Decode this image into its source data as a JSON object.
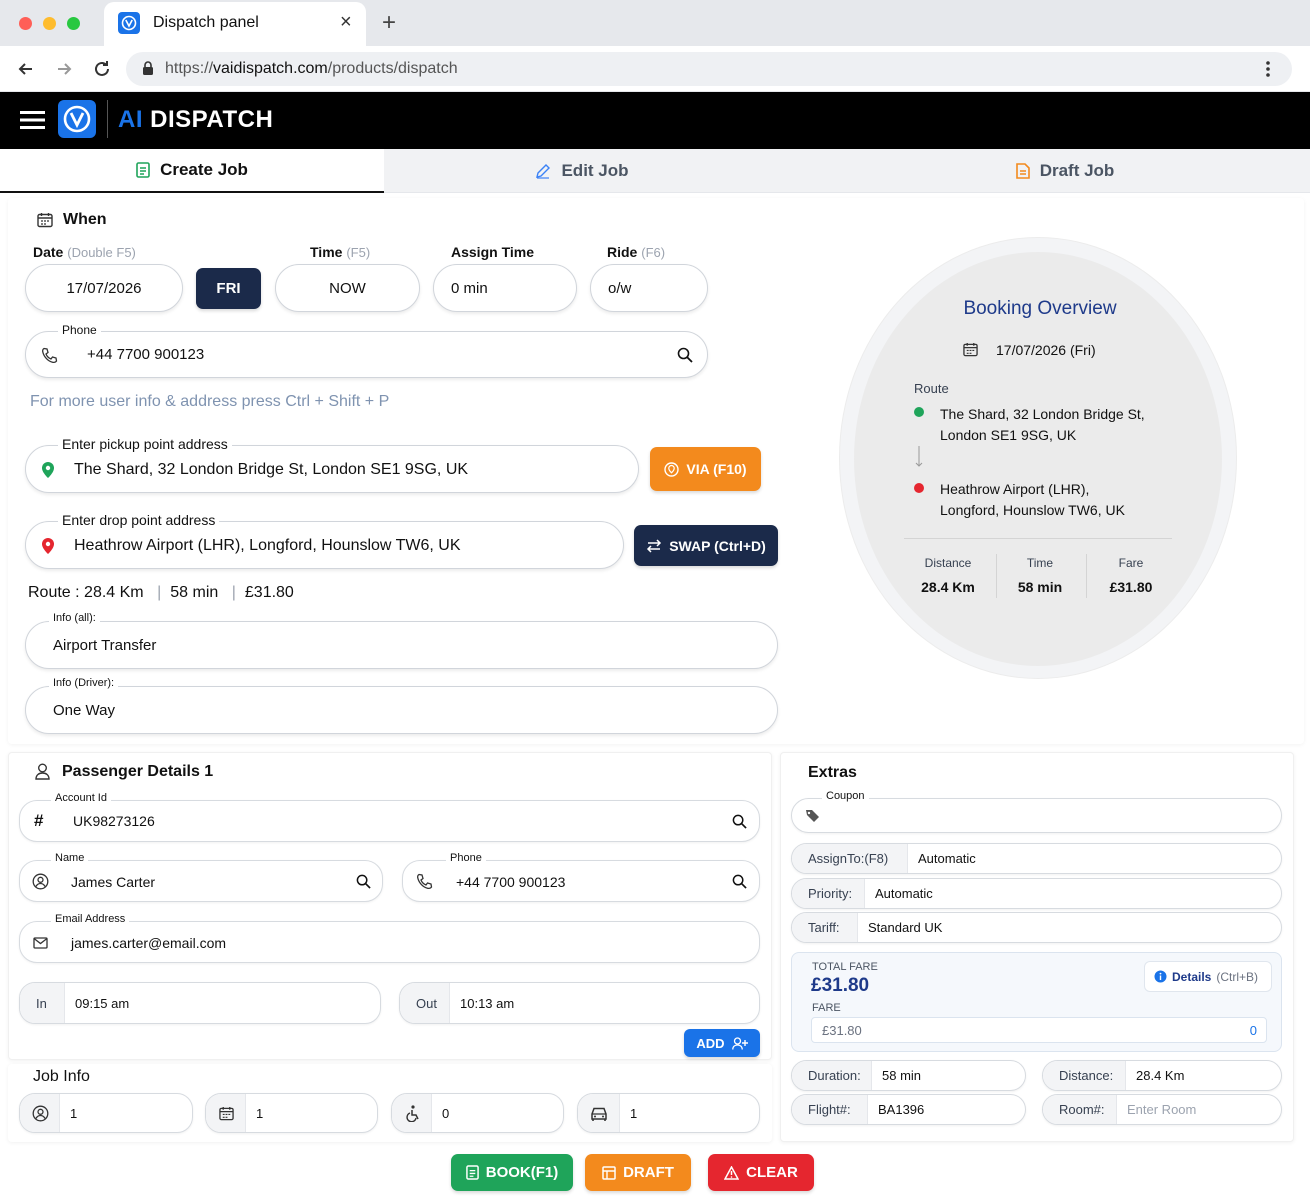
{
  "browser": {
    "tab_title": "Dispatch panel",
    "url_prefix": "https://",
    "url_host": "vaidispatch.com",
    "url_path": "/products/dispatch"
  },
  "app": {
    "brand_ai": "AI",
    "brand_rest": "DISPATCH"
  },
  "tabs": {
    "create": "Create Job",
    "edit": "Edit Job",
    "draft": "Draft Job"
  },
  "when": {
    "title": "When",
    "date_label": "Date",
    "date_hint": "(Double F5)",
    "time_label": "Time",
    "time_hint": "(F5)",
    "assign_label": "Assign Time",
    "ride_label": "Ride",
    "ride_hint": "(F6)",
    "date_value": "17/07/2026",
    "day_button": "FRI",
    "time_value": "NOW",
    "assign_value": "0 min",
    "ride_value": "o/w"
  },
  "phone": {
    "label": "Phone",
    "value": "+44 7700 900123"
  },
  "hint_text": "For more user info & address press Ctrl + Shift + P",
  "pickup": {
    "label": "Enter pickup point address",
    "value": "The Shard, 32 London Bridge St, London SE1 9SG, UK",
    "via_button": "VIA (F10)"
  },
  "drop": {
    "label": "Enter drop point address",
    "value": "Heathrow Airport (LHR), Longford, Hounslow TW6, UK",
    "swap_button": "SWAP (Ctrl+D)"
  },
  "route": {
    "prefix": "Route :",
    "distance": "28.4 Km",
    "sep": "|",
    "time": "58 min",
    "fare": "£31.80"
  },
  "info_all": {
    "label": "Info (all):",
    "value": "Airport Transfer"
  },
  "info_driver": {
    "label": "Info (Driver):",
    "value": "One Way"
  },
  "overview": {
    "title": "Booking Overview",
    "date": "17/07/2026 (Fri)",
    "route_label": "Route",
    "from_line1": "The Shard, 32 London Bridge St,",
    "from_line2": "London SE1 9SG, UK",
    "to_line1": "Heathrow Airport (LHR),",
    "to_line2": "Longford, Hounslow TW6, UK",
    "distance_label": "Distance",
    "distance": "28.4 Km",
    "time_label": "Time",
    "time": "58 min",
    "fare_label": "Fare",
    "fare": "£31.80"
  },
  "passenger": {
    "title": "Passenger Details 1",
    "account_label": "Account Id",
    "account_value": "UK98273126",
    "name_label": "Name",
    "name_value": "James Carter",
    "phone_label": "Phone",
    "phone_value": "+44 7700 900123",
    "email_label": "Email Address",
    "email_value": "james.carter@email.com",
    "in_label": "In",
    "in_value": "09:15 am",
    "out_label": "Out",
    "out_value": "10:13 am",
    "add_button": "ADD"
  },
  "job_info": {
    "title": "Job Info",
    "passengers": "1",
    "days": "1",
    "wheelchairs": "0",
    "vehicles": "1"
  },
  "extras": {
    "title": "Extras",
    "coupon_label": "Coupon",
    "coupon_value": "",
    "assign_to_label": "AssignTo:(F8)",
    "assign_to_value": "Automatic",
    "priority_label": "Priority:",
    "priority_value": "Automatic",
    "tariff_label": "Tariff:",
    "tariff_value": "Standard UK",
    "total_fare_label": "TOTAL FARE",
    "total_fare_value": "£31.80",
    "details_label": "Details",
    "details_hint": "(Ctrl+B)",
    "fare_label": "FARE",
    "fare_value": "£31.80",
    "fare_extra": "0",
    "duration_label": "Duration:",
    "duration_value": "58 min",
    "distance_label": "Distance:",
    "distance_value": "28.4 Km",
    "flight_label": "Flight#:",
    "flight_value": "BA1396",
    "room_label": "Room#:",
    "room_placeholder": "Enter Room"
  },
  "actions": {
    "book": "BOOK(F1)",
    "draft": "DRAFT",
    "clear": "CLEAR"
  },
  "colors": {
    "navy": "#1b2a4a",
    "orange": "#f38a1d",
    "green": "#1fa45a",
    "red": "#e5262f",
    "blue": "#1a73e8",
    "overview_title": "#1e3a8a"
  }
}
